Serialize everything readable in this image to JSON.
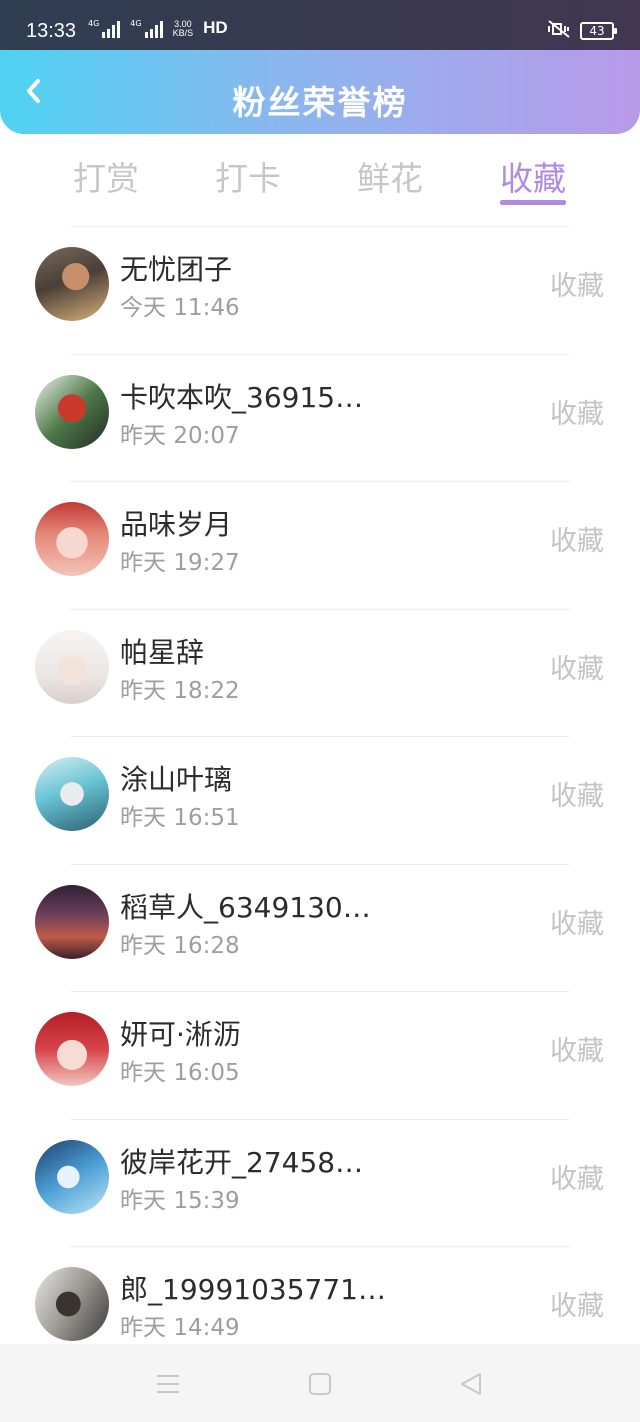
{
  "status_bar": {
    "time": "13:33",
    "net1": "4G",
    "net2": "4G",
    "speed_top": "3.00",
    "speed_bottom": "KB/S",
    "hd": "HD",
    "battery": "43"
  },
  "header": {
    "title": "粉丝荣誉榜"
  },
  "tabs": [
    {
      "label": "打赏"
    },
    {
      "label": "打卡"
    },
    {
      "label": "鲜花"
    },
    {
      "label": "收藏"
    }
  ],
  "active_tab": "收藏",
  "colors": {
    "accent": "#b08be0",
    "header_start": "#4ed3f1",
    "header_end": "#b99ae9"
  },
  "fans": [
    {
      "name": "无忧团子",
      "day": "今天",
      "time": "11:46",
      "action": "收藏"
    },
    {
      "name": "卡吹本吹_36915…",
      "day": "昨天",
      "time": "20:07",
      "action": "收藏"
    },
    {
      "name": "品味岁月",
      "day": "昨天",
      "time": "19:27",
      "action": "收藏"
    },
    {
      "name": "帕星辞",
      "day": "昨天",
      "time": "18:22",
      "action": "收藏"
    },
    {
      "name": "涂山叶璃",
      "day": "昨天",
      "time": "16:51",
      "action": "收藏"
    },
    {
      "name": "稻草人_6349130…",
      "day": "昨天",
      "time": "16:28",
      "action": "收藏"
    },
    {
      "name": "妍可·淅沥",
      "day": "昨天",
      "time": "16:05",
      "action": "收藏"
    },
    {
      "name": "彼岸花开_27458…",
      "day": "昨天",
      "time": "15:39",
      "action": "收藏"
    },
    {
      "name": "郎_19991035771…",
      "day": "昨天",
      "time": "14:49",
      "action": "收藏"
    }
  ]
}
